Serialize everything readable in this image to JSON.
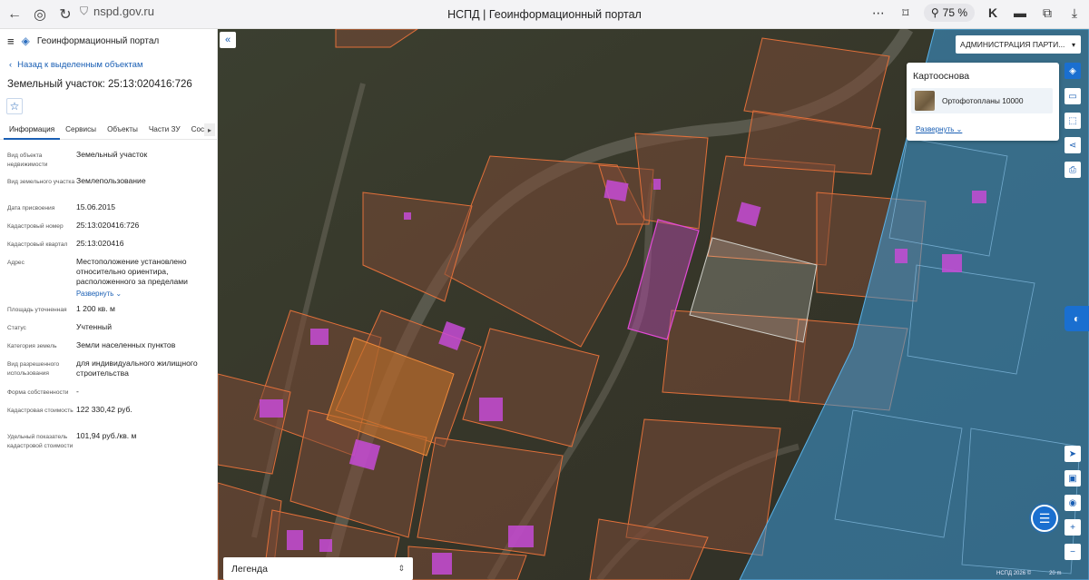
{
  "browser": {
    "url": "nspd.gov.ru",
    "title": "НСПД | Геоинформационный портал",
    "zoom": "75 %"
  },
  "app": {
    "name": "Геоинформационный портал",
    "back_link": "Назад к выделенным объектам",
    "object_title": "Земельный участок: 25:13:020416:726"
  },
  "tabs": [
    {
      "label": "Информация",
      "active": true
    },
    {
      "label": "Сервисы"
    },
    {
      "label": "Объекты"
    },
    {
      "label": "Части ЗУ"
    },
    {
      "label": "Соста"
    }
  ],
  "properties": [
    {
      "label": "Вид объекта недвижимости",
      "value": "Земельный участок"
    },
    {
      "label": "Вид земельного участка",
      "value": "Землепользование"
    },
    {
      "label": "Дата присвоения",
      "value": "15.06.2015"
    },
    {
      "label": "Кадастровый номер",
      "value": "25:13:020416:726"
    },
    {
      "label": "Кадастровый квартал",
      "value": "25:13:020416"
    },
    {
      "label": "Адрес",
      "value": "Местоположение установлено относительно ориентира, расположенного за пределами"
    },
    {
      "label": "Площадь уточненная",
      "value": "1 200 кв. м"
    },
    {
      "label": "Статус",
      "value": "Учтенный"
    },
    {
      "label": "Категория земель",
      "value": "Земли населенных пунктов"
    },
    {
      "label": "Вид разрешенного использования",
      "value": "для индивидуального жилищного строительства"
    },
    {
      "label": "Форма собственности",
      "value": "-"
    },
    {
      "label": "Кадастровая стоимость",
      "value": "122 330,42 руб."
    },
    {
      "label": "Удельный показатель кадастровой стоимости",
      "value": "101,94 руб./кв. м"
    }
  ],
  "address_expand": "Развернуть",
  "map": {
    "admin_select": "АДМИНИСТРАЦИЯ ПАРТИ...",
    "basemap_title": "Картооснова",
    "basemap_item": "Ортофотопланы 10000",
    "basemap_expand": "Развернуть",
    "legend": "Легенда",
    "attribution": "НСПД 2026 ©",
    "scale": "20 m"
  },
  "colors": {
    "accent": "#1a6fd0",
    "parcel_stroke": "#e2703a",
    "building_fill": "#c54bd6",
    "zone_fill": "#3a9ad9"
  }
}
